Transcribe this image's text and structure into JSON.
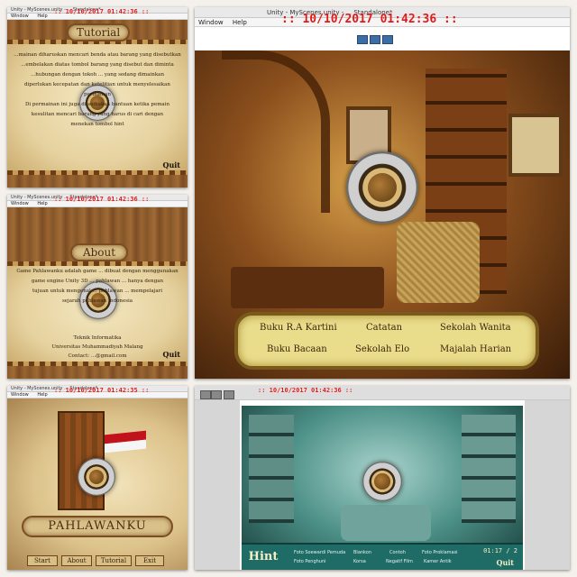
{
  "collage": {
    "tutorial": {
      "window_title": "Unity - MyScenes.unity - ... Standalone*",
      "menu": [
        "Window",
        "Help"
      ],
      "timestamp": ":: 10/10/2017 01:42:36 ::",
      "heading": "Tutorial",
      "body_lines": [
        "...mainan diharuskan mencari benda atau barang yang disebutkan",
        "...embelakan diatas tombol barang yang disebut dan diminta",
        "...hubungan dengan tokoh ... yang sedang dimainkan",
        "diperlukan kecepatan dan ketelitian untuk menyelesaikan permainan",
        "Di permainan ini juga di sediakan bantuan ketika pemain",
        "kesulitan mencari barang yang harus di cari dengan",
        "menekan tombol hint"
      ],
      "quit_label": "Quit"
    },
    "about": {
      "window_title": "Unity - MyScenes.unity ... Standalone*",
      "menu": [
        "Window",
        "Help"
      ],
      "timestamp": ":: 10/10/2017 01:42:36 ::",
      "heading": "About",
      "body_lines": [
        "Game Pahlawanku adalah game ... dibuat dengan menggunakan",
        "game engine Unity 3D ... pahlawan ... hanya dengan",
        "tujuan untuk mengenal ... pahlawan ... mempelajari",
        "sejarah pahlawan Indonesia"
      ],
      "credits": [
        "Teknik Informatika",
        "Universitas Muhammadiyah Malang",
        "Contact: ...@gmail.com"
      ],
      "quit_label": "Quit"
    },
    "main_menu": {
      "window_title": "Unity - MyScenes.unity ... Standalone*",
      "menu": [
        "Window",
        "Help"
      ],
      "timestamp": ":: 10/10/2017 01:42:35 ::",
      "game_title": "PAHLAWANKU",
      "buttons": [
        "Start",
        "About",
        "Tutorial",
        "Exit"
      ]
    },
    "scene_kartini": {
      "window_title": "Unity - MyScenes.unity - ... Standalone*",
      "menu": [
        "Window",
        "Help"
      ],
      "timestamp": ":: 10/10/2017 01:42:36 ::",
      "item_list": [
        [
          "Buku R.A Kartini",
          "Catatan",
          "Sekolah Wanita"
        ],
        [
          "Buku Bacaan",
          "Sekolah Elo",
          "Majalah Harian"
        ]
      ]
    },
    "scene_teal": {
      "timestamp": ":: 10/10/2017 01:42:36 ::",
      "hint_label": "Hint",
      "item_list": [
        [
          "Foto Soewardi Pemuda",
          "Blankon",
          "Contoh",
          "Foto Proklamasi"
        ],
        [
          "Foto Penghuni",
          "Korsa",
          "Negatif Film",
          "Kamer Antik"
        ]
      ],
      "timer": "01:17 / 2",
      "quit_label": "Quit"
    }
  },
  "colors": {
    "timestamp": "#e01818",
    "wood": "#8a5a2b",
    "teal_panel": "#1f6b66"
  },
  "icons": [
    "play-icon",
    "pause-icon",
    "step-icon",
    "emblem-logo"
  ]
}
